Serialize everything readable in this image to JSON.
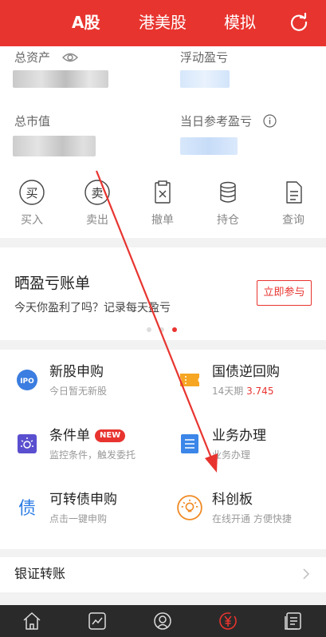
{
  "topbar": {
    "tabs": [
      "A股",
      "港美股",
      "模拟"
    ],
    "active_tab": "A股"
  },
  "assets": {
    "total_assets_label": "总资产",
    "floating_pl_label": "浮动盈亏",
    "market_value_label": "总市值",
    "daily_pl_label": "当日参考盈亏"
  },
  "actions": [
    {
      "label": "买入",
      "glyph": "买"
    },
    {
      "label": "卖出",
      "glyph": "卖"
    },
    {
      "label": "撤单"
    },
    {
      "label": "持仓"
    },
    {
      "label": "查询"
    }
  ],
  "banner": {
    "title": "晒盈亏账单",
    "subtitle": "今天你盈利了吗？记录每天盈亏",
    "cta": "立即参与"
  },
  "services": [
    {
      "title": "新股申购",
      "sub": "今日暂无新股",
      "icon": "ipo-icon"
    },
    {
      "title": "国债逆回购",
      "sub_prefix": "14天期 ",
      "sub_value": "3.745",
      "icon": "ticket-icon"
    },
    {
      "title": "条件单",
      "badge": "NEW",
      "sub": "监控条件，触发委托",
      "icon": "condition-icon"
    },
    {
      "title": "业务办理",
      "sub": "业务办理",
      "icon": "list-icon"
    },
    {
      "title": "可转债申购",
      "sub": "点击一键申购",
      "icon_glyph": "债"
    },
    {
      "title": "科创板",
      "sub": "在线开通 方便快捷",
      "icon": "bulb-icon"
    }
  ],
  "bank": {
    "label": "银证转账"
  },
  "colors": {
    "brand": "#e8342f",
    "nav_bg": "#2a2a2a"
  }
}
